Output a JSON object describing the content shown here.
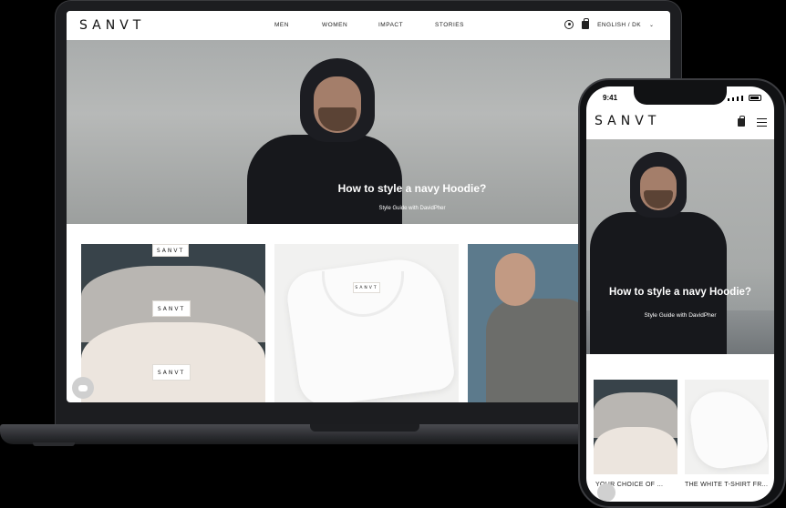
{
  "brand": "SANVT",
  "desktop": {
    "nav": {
      "items": [
        "MEN",
        "WOMEN",
        "IMPACT",
        "STORIES"
      ],
      "language": "ENGLISH / DK"
    },
    "hero": {
      "title": "How to style a navy Hoodie?",
      "subtitle": "Style Guide with DavidPher"
    },
    "cards": {
      "tag_text": "SANVT"
    }
  },
  "mobile": {
    "status": {
      "time": "9:41"
    },
    "hero": {
      "title": "How to style a navy Hoodie?",
      "subtitle": "Style Guide with DavidPher"
    },
    "products": [
      {
        "label": "YOUR CHOICE OF ..."
      },
      {
        "label": "THE WHITE T-SHIRT FR..."
      }
    ]
  },
  "colors": {
    "hoodie": "#1c1d22",
    "sky": "#b2b4b3",
    "text": "#111111"
  }
}
